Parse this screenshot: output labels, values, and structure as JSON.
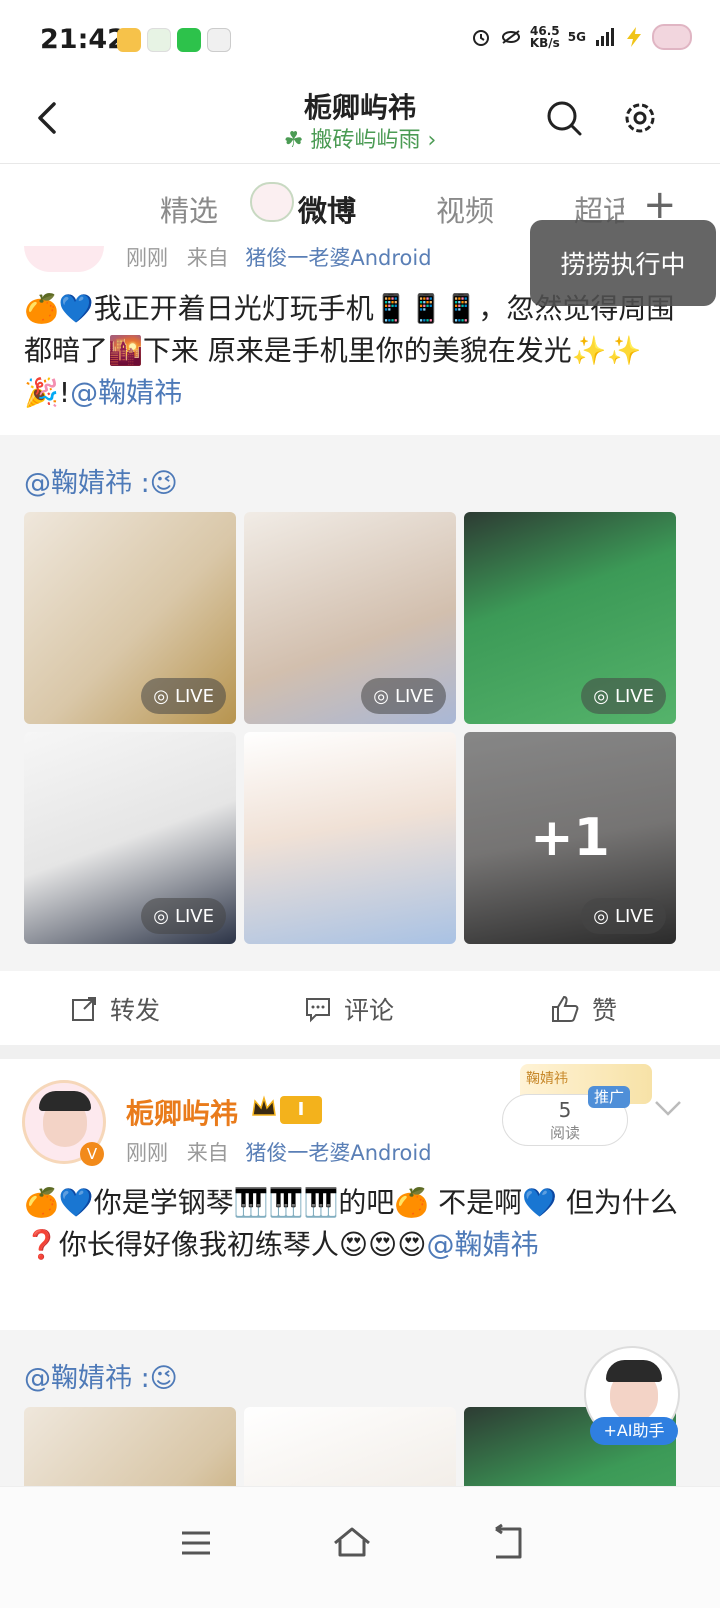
{
  "status_bar": {
    "time": "21:42",
    "speed_value": "46.5",
    "speed_unit": "KB/s",
    "network": "5G"
  },
  "header": {
    "title": "栀卿屿祎",
    "subtitle": "搬砖屿屿雨 ›",
    "subtitle_icon": "clover-icon"
  },
  "tabs": [
    {
      "label": "精选"
    },
    {
      "label": "微博"
    },
    {
      "label": "视频"
    },
    {
      "label": "超话"
    }
  ],
  "toast": "捞捞执行中",
  "post1": {
    "time": "刚刚",
    "from_prefix": "来自",
    "source": "猪俊一老婆Android",
    "text": "🍊💙我正开着日光灯玩手机📱📱📱，忽然觉得周围都暗了🌇下来   原来是手机里你的美貌在发光✨✨🎉!",
    "mention": "@鞠婧祎",
    "repost_header": "@鞠婧祎 :😉",
    "live_label": "LIVE",
    "more_count": "+1"
  },
  "actions": {
    "repost": "转发",
    "comment": "评论",
    "like": "赞"
  },
  "post2": {
    "username": "栀卿屿祎",
    "badge": "I",
    "time": "刚刚",
    "from_prefix": "来自",
    "source": "猪俊一老婆Android",
    "text": "🍊💙你是学钢琴🎹🎹🎹的吧🍊 不是啊💙 但为什么❓你长得好像我初练琴人😍😍😍",
    "mention": "@鞠婧祎",
    "read_count": "5",
    "read_label": "阅读",
    "ad_tag": "推广",
    "card_name": "鞠婧祎",
    "repost_header": "@鞠婧祎 :😉"
  },
  "ai_assistant": "+AI助手"
}
